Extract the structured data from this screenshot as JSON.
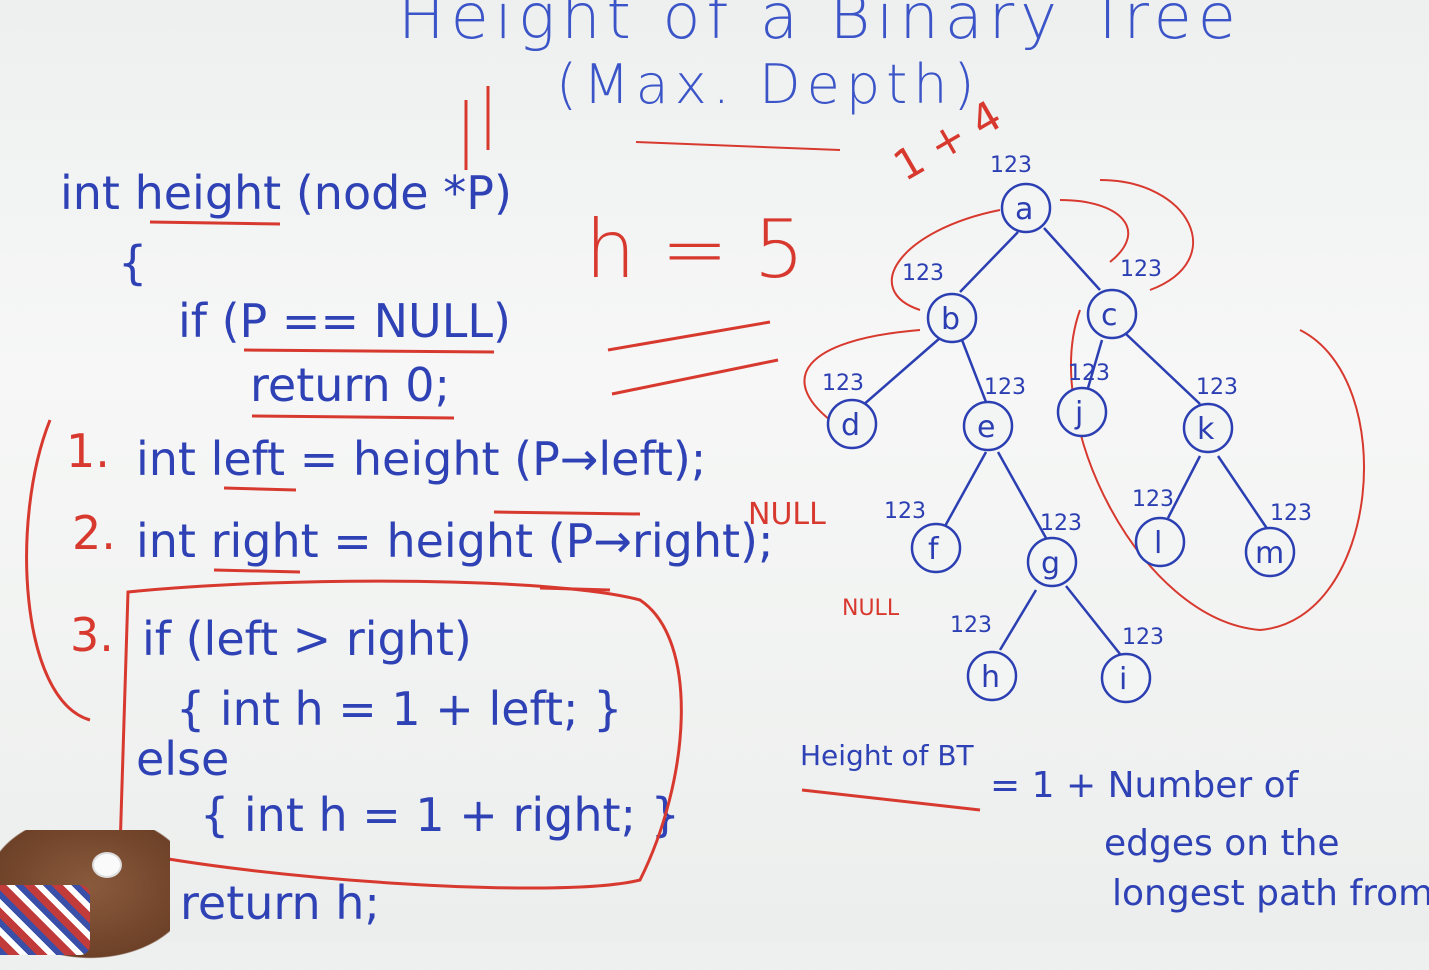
{
  "title": {
    "line1": "Height of a Binary Tree",
    "line2": "(Max. Depth)"
  },
  "code": {
    "signature": "int height (node *P)",
    "open_brace": "{",
    "if_null": "if (P == NULL)",
    "return_zero": "return 0;",
    "step1_num": "1.",
    "step1": "int left = height (P→left);",
    "step2_num": "2.",
    "step2": "int right = height (P→right);",
    "step3_num": "3.",
    "if_cmp": "if (left > right)",
    "then_branch": "{ int h = 1 + left; }",
    "else_kw": "else",
    "else_branch": "{ int h = 1 + right; }",
    "return_h": "return h;"
  },
  "annotations": {
    "h_eq": "h = 5",
    "one_plus_four": "1 + 4",
    "null_d": "NULL",
    "null_f": "NULL"
  },
  "tree": {
    "nodes": [
      "a",
      "b",
      "c",
      "d",
      "e",
      "j",
      "k",
      "f",
      "g",
      "l",
      "m",
      "h",
      "i"
    ],
    "counter": "123"
  },
  "definition": {
    "label": "Height of BT",
    "text1": "= 1 + Number of",
    "text2": "edges on the",
    "text3": "longest path from"
  },
  "colors": {
    "blue_marker": "#2b3fb3",
    "red_marker": "#d8392f",
    "board": "#f2f3f2"
  }
}
